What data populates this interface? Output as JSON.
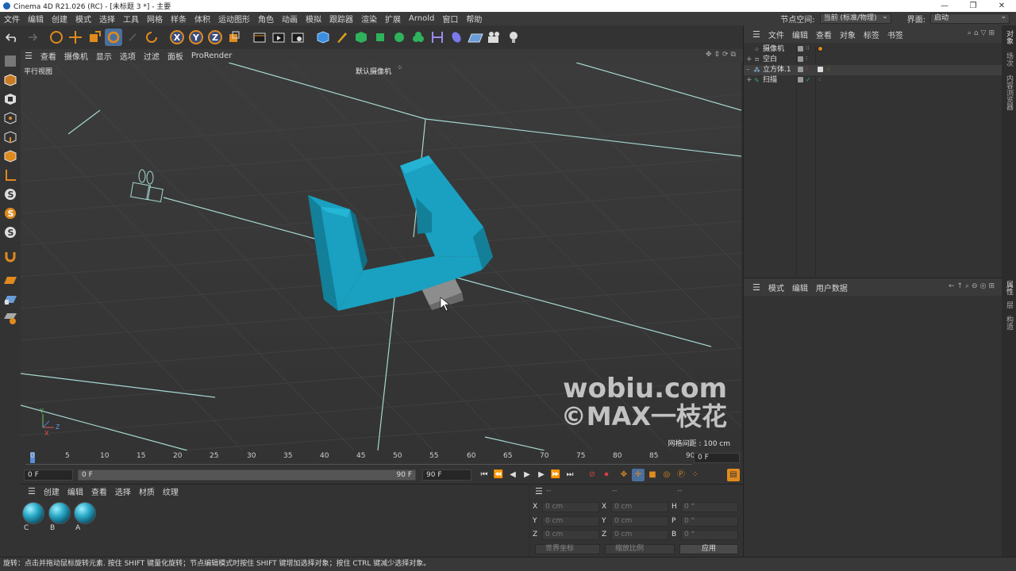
{
  "titlebar": {
    "title": "Cinema 4D R21.026 (RC) - [未标题 3 *] - 主要",
    "minimize": "—",
    "restore": "❐",
    "close": "✕"
  },
  "menubar": {
    "items": [
      "文件",
      "编辑",
      "创建",
      "模式",
      "选择",
      "工具",
      "网格",
      "样条",
      "体积",
      "运动图形",
      "角色",
      "动画",
      "模拟",
      "跟踪器",
      "渲染",
      "扩展",
      "Arnold",
      "窗口",
      "帮助"
    ],
    "node_space_label": "节点空间:",
    "node_space_value": "当前 (标准/物理)",
    "layout_label": "界面:",
    "layout_value": "启动"
  },
  "toolbar": {
    "x": "X",
    "y": "Y",
    "z": "Z"
  },
  "viewport": {
    "menu": [
      "查看",
      "摄像机",
      "显示",
      "选项",
      "过滤",
      "面板",
      "ProRender"
    ],
    "view_name": "平行视图",
    "camera_name": "默认摄像机",
    "grid_spacing": "网格间距 : 100 cm",
    "watermark_line1": "wobiu.com",
    "watermark_line2": "©MAX一枝花"
  },
  "timeline": {
    "ticks": [
      "0",
      "5",
      "10",
      "15",
      "20",
      "25",
      "30",
      "35",
      "40",
      "45",
      "50",
      "55",
      "60",
      "65",
      "70",
      "75",
      "80",
      "85",
      "90"
    ],
    "current_frame": "0 F"
  },
  "transport": {
    "start": "0 F",
    "range_start": "0 F",
    "range_end": "90 F",
    "end": "90 F"
  },
  "materials": {
    "menu": [
      "创建",
      "编辑",
      "查看",
      "选择",
      "材质",
      "纹理"
    ],
    "items": [
      "C",
      "B",
      "A"
    ]
  },
  "coordinates": {
    "headers": [
      "--",
      "--",
      "--"
    ],
    "col1": [
      {
        "label": "X",
        "value": "0 cm"
      },
      {
        "label": "Y",
        "value": "0 cm"
      },
      {
        "label": "Z",
        "value": "0 cm"
      }
    ],
    "col2": [
      {
        "label": "X",
        "value": "0 cm"
      },
      {
        "label": "Y",
        "value": "0 cm"
      },
      {
        "label": "Z",
        "value": "0 cm"
      }
    ],
    "col3": [
      {
        "label": "H",
        "value": "0 °"
      },
      {
        "label": "P",
        "value": "0 °"
      },
      {
        "label": "B",
        "value": "0 °"
      }
    ],
    "space": "世界坐标",
    "scale": "缩放比例",
    "apply": "应用"
  },
  "object_manager": {
    "menu": [
      "文件",
      "编辑",
      "查看",
      "对象",
      "标签",
      "书签"
    ],
    "objects": [
      "摄像机",
      "空白",
      "立方体.1",
      "扫描"
    ]
  },
  "attribute_manager": {
    "menu": [
      "模式",
      "编辑",
      "用户数据"
    ]
  },
  "side_tabs": [
    "对象",
    "场次",
    "内容浏览器",
    "属性",
    "层",
    "构造"
  ],
  "status": "旋转：点击并拖动鼠标旋转元素. 按住 SHIFT 键量化旋转；节点编辑模式时按住 SHIFT 键增加选择对象；按住 CTRL 键减少选择对象。",
  "colors": {
    "accent": "#1aa0c0",
    "selected": "#4b6f9c",
    "orange": "#e08a1e"
  }
}
